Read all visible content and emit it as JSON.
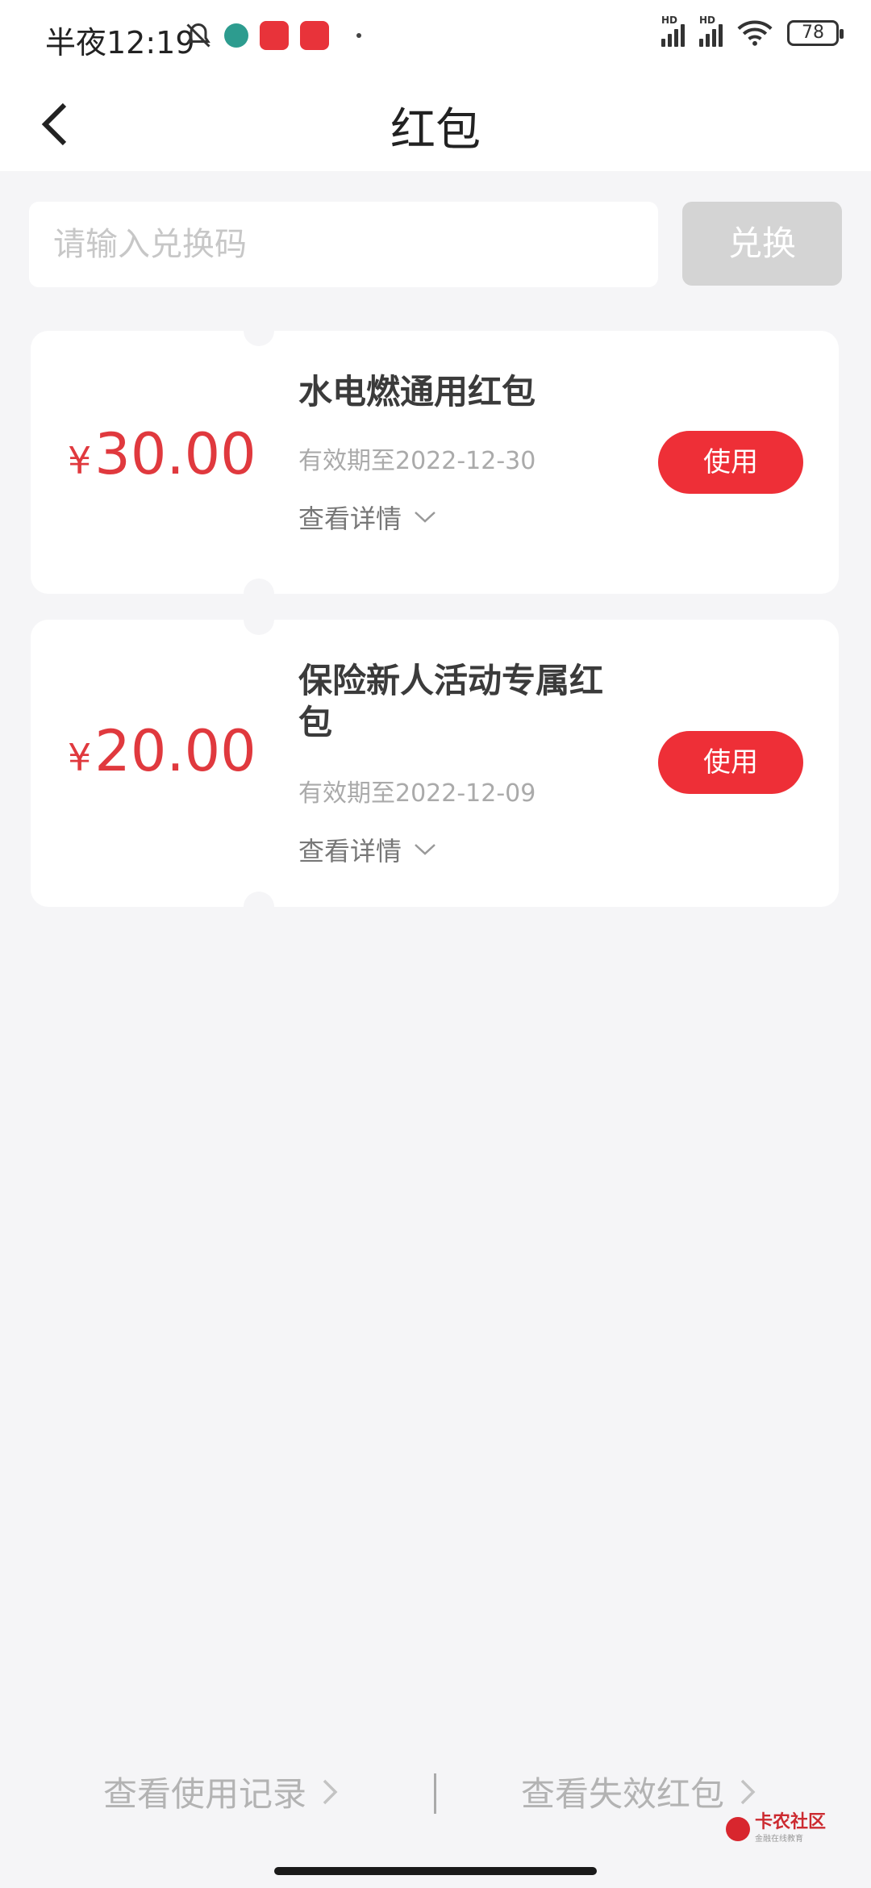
{
  "status_bar": {
    "time": "半夜12:19",
    "battery": "78",
    "network_labels": [
      "HD",
      "HD"
    ]
  },
  "header": {
    "title": "红包"
  },
  "redeem": {
    "placeholder": "请输入兑换码",
    "button_label": "兑换"
  },
  "cards": [
    {
      "currency": "¥",
      "amount": "30.00",
      "title": "水电燃通用红包",
      "expiry": "有效期至2022-12-30",
      "detail_label": "查看详情",
      "use_label": "使用"
    },
    {
      "currency": "¥",
      "amount": "20.00",
      "title": "保险新人活动专属红包",
      "expiry": "有效期至2022-12-09",
      "detail_label": "查看详情",
      "use_label": "使用"
    }
  ],
  "footer": {
    "usage_record_label": "查看使用记录",
    "expired_label": "查看失效红包"
  },
  "watermark": {
    "name": "卡农社区",
    "subtitle": "金融在线教育"
  },
  "colors": {
    "accent_red": "#ee2f37",
    "amount_red": "#e0393e",
    "background": "#f5f5f7"
  }
}
